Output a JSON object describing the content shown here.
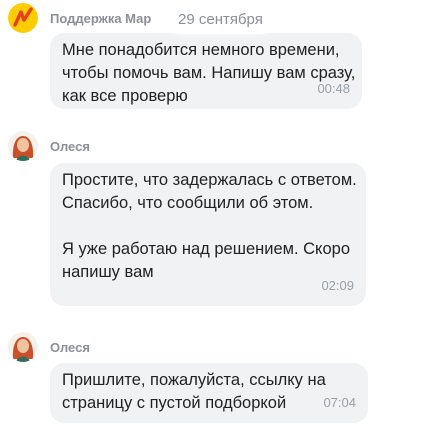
{
  "date_chip": "29 сентября",
  "colors": {
    "bubble_bg": "#f1f2f4",
    "sender_name": "#8a8f98",
    "timestamp": "#9aa0a8"
  },
  "messages": [
    {
      "sender": "Поддержка Мар",
      "avatar_icon": "support-logo-icon",
      "text": "Мне понадобится немного времени, чтобы помочь вам. Напишу вам сразу, как все проверю",
      "time": "00:48"
    },
    {
      "sender": "Олеся",
      "avatar_icon": "user-avatar-icon",
      "text": "Простите, что задержалась с ответом. Спасибо, что сообщили об этом.\n\nЯ уже работаю над решением. Скоро напишу вам",
      "time": "02:09"
    },
    {
      "sender": "Олеся",
      "avatar_icon": "user-avatar-icon",
      "text": "Пришлите, пожалуйста, ссылку на страницу с пустой подборкой",
      "time": "07:04"
    }
  ]
}
